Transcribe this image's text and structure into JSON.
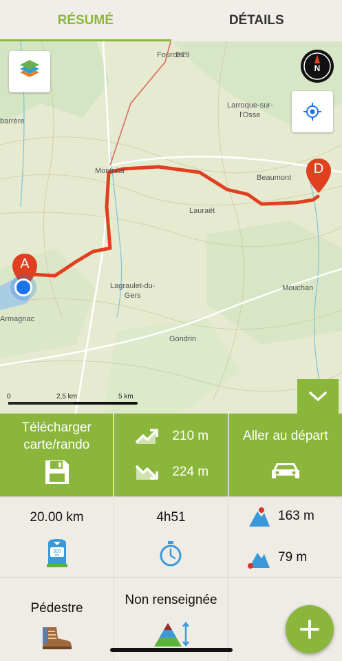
{
  "tabs": [
    {
      "label": "RÉSUMÉ",
      "active": true
    },
    {
      "label": "DÉTAILS",
      "active": false
    }
  ],
  "map": {
    "places": {
      "fourcesTop": "Fources",
      "roadNumber": "D29",
      "larroque": "Larroque-sur-\nl'Osse",
      "barbarre": "barrère",
      "montreal": "Montréal",
      "beaumont": "Beaumont",
      "lauraet": "Lauraët",
      "lagraulet": "Lagraulet-du-\nGers",
      "mouchan": "Mouchan",
      "armagnac": "Armagnac",
      "gondrin": "Gondrin"
    },
    "marker_start": "A",
    "marker_end": "D",
    "scale": {
      "zero": "0",
      "mid": "2,5 km",
      "end": "5 km"
    },
    "route_color": "#e0401f",
    "icons": {
      "layers": "layers-icon",
      "compass": "compass-icon",
      "locate": "locate-icon",
      "collapse": "chevron-down-icon"
    }
  },
  "actions": {
    "download_label": "Télécharger\ncarte/rando",
    "ascent": "210 m",
    "descent": "224 m",
    "go_start_label": "Aller au départ"
  },
  "stats": {
    "distance": "20.00 km",
    "duration": "4h51",
    "alt_max": "163 m",
    "alt_min": "79 m",
    "mode": "Pédestre",
    "difficulty": "Non renseignée"
  },
  "colors": {
    "accent": "#8ab73b"
  }
}
